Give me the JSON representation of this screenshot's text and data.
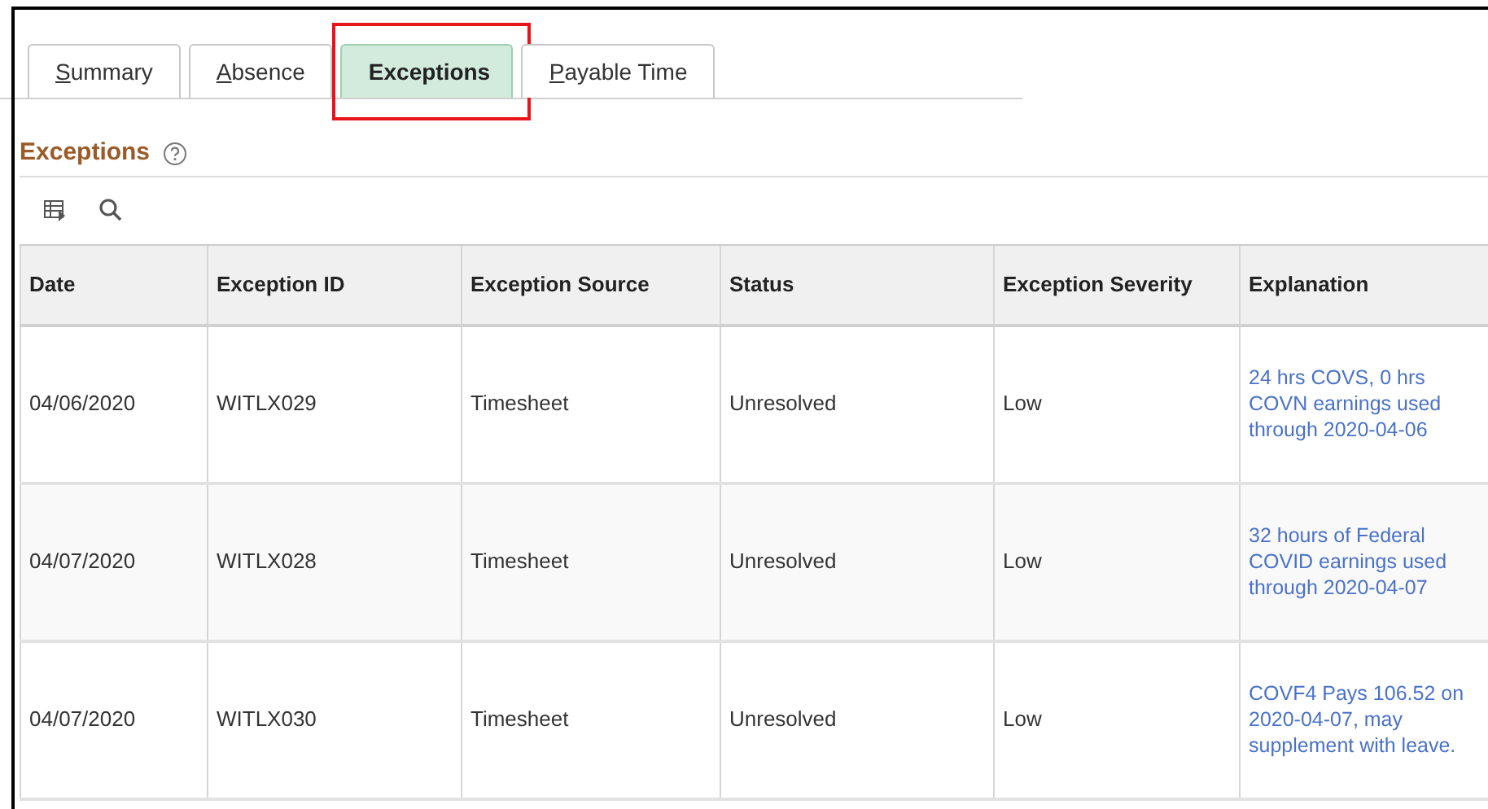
{
  "tabs": [
    {
      "label": "Summary",
      "selected": false,
      "underlined_key": true,
      "annotated": false
    },
    {
      "label": "Absence",
      "selected": false,
      "underlined_key": true,
      "annotated": false
    },
    {
      "label": "Exceptions",
      "selected": true,
      "underlined_key": false,
      "annotated": true
    },
    {
      "label": "Payable Time",
      "selected": false,
      "underlined_key": true,
      "annotated": false
    }
  ],
  "section": {
    "title": "Exceptions"
  },
  "table": {
    "columns": [
      "Date",
      "Exception ID",
      "Exception Source",
      "Status",
      "Exception Severity",
      "Explanation"
    ],
    "rows": [
      {
        "cells": [
          "04/06/2020",
          "WITLX029",
          "Timesheet",
          "Unresolved",
          "Low"
        ],
        "explanation": "24 hrs COVS, 0 hrs COVN earnings used through 2020-04-06"
      },
      {
        "cells": [
          "04/07/2020",
          "WITLX028",
          "Timesheet",
          "Unresolved",
          "Low"
        ],
        "explanation": "32 hours of Federal COVID earnings used through 2020-04-07"
      },
      {
        "cells": [
          "04/07/2020",
          "WITLX030",
          "Timesheet",
          "Unresolved",
          "Low"
        ],
        "explanation": "COVF4 Pays 106.52 on 2020-04-07, may supplement with leave."
      }
    ]
  }
}
